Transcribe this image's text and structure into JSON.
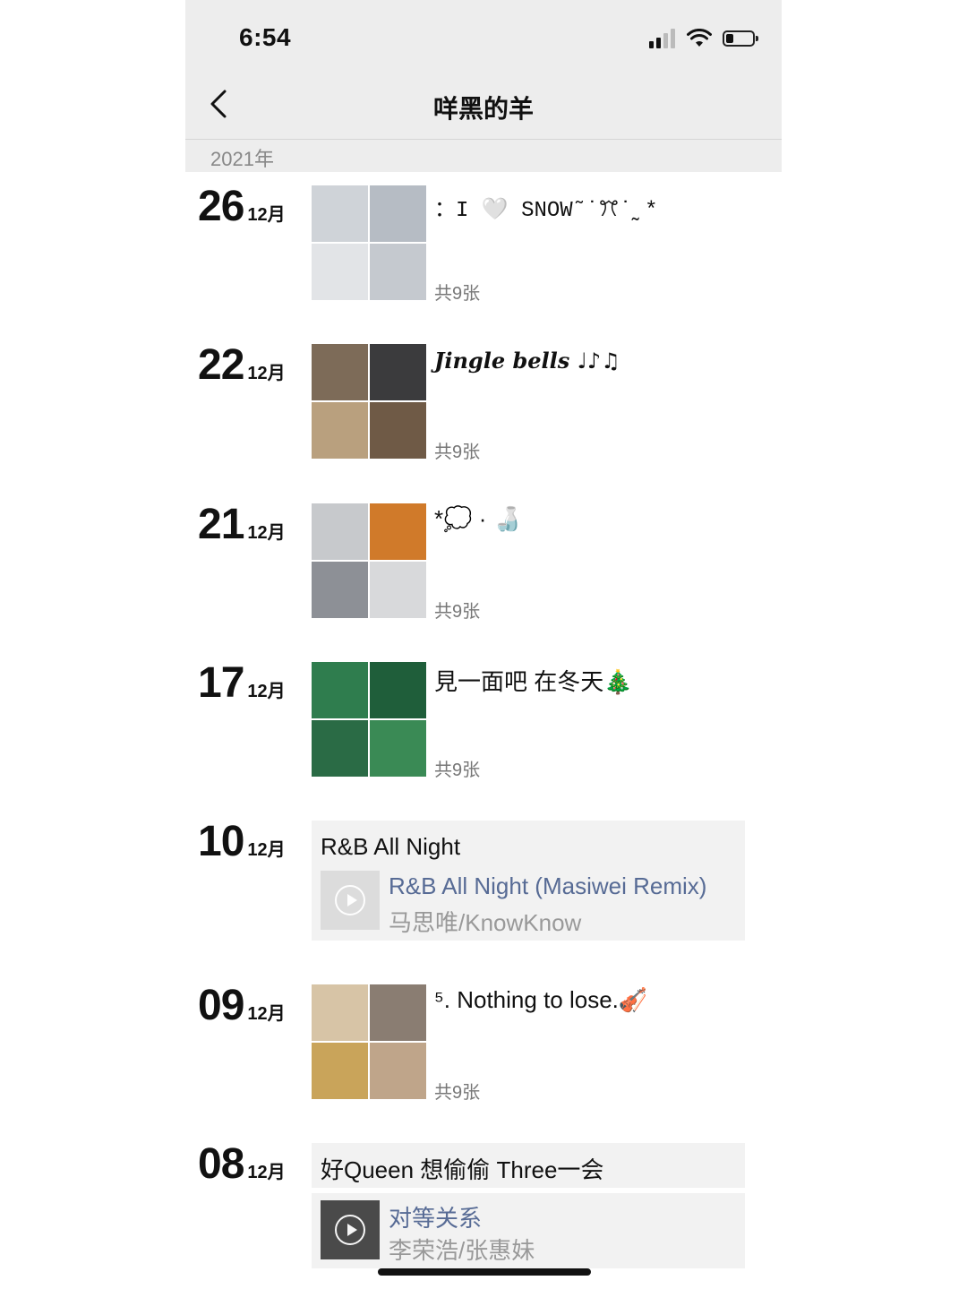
{
  "status_bar": {
    "time": "6:54",
    "battery_level": 0.3
  },
  "nav": {
    "title": "咩黑的羊",
    "back_icon": "chevron-left-icon"
  },
  "year": "2021年",
  "entries": [
    {
      "kind": "photos",
      "day": "26",
      "month": "12月",
      "caption": "：I 🤍 SNOW˜˙ꔫ˙˷*",
      "count": "共9张",
      "thumbs": [
        "#cfd3d8",
        "#b6bcc4",
        "#e2e4e7",
        "#c5c9cf"
      ]
    },
    {
      "kind": "photos",
      "day": "22",
      "month": "12月",
      "caption": "Jingle bells ♩♪♫",
      "count": "共9张",
      "thumbs": [
        "#7d6b58",
        "#3b3b3d",
        "#b9a07e",
        "#6f5a46"
      ]
    },
    {
      "kind": "photos",
      "day": "21",
      "month": "12月",
      "caption": "*💭 · 🍶",
      "count": "共9张",
      "thumbs": [
        "#c7c9cc",
        "#d07a2a",
        "#8d9096",
        "#d8d9db"
      ]
    },
    {
      "kind": "photos",
      "day": "17",
      "month": "12月",
      "caption": "見一面吧 在冬天🎄",
      "count": "共9张",
      "thumbs": [
        "#2f7d4e",
        "#1f5e3a",
        "#2a6b45",
        "#3a8a55"
      ]
    },
    {
      "kind": "music",
      "day": "10",
      "month": "12月",
      "title": "R&B All Night",
      "song": "R&B All Night (Masiwei Remix)",
      "artist": "马思唯/KnowKnow",
      "cover": "#dcdcdc"
    },
    {
      "kind": "photos",
      "day": "09",
      "month": "12月",
      "caption": "⁵. Nothing to lose.🎻",
      "count": "共9张",
      "thumbs": [
        "#d7c4a6",
        "#8a7d72",
        "#c9a45a",
        "#bfa58a"
      ]
    },
    {
      "kind": "music",
      "day": "08",
      "month": "12月",
      "title": "好Queen 想偷偷 Three一会",
      "song": "对等关系",
      "artist": "李荣浩/张惠妹",
      "cover": "#4a4a4a"
    }
  ]
}
